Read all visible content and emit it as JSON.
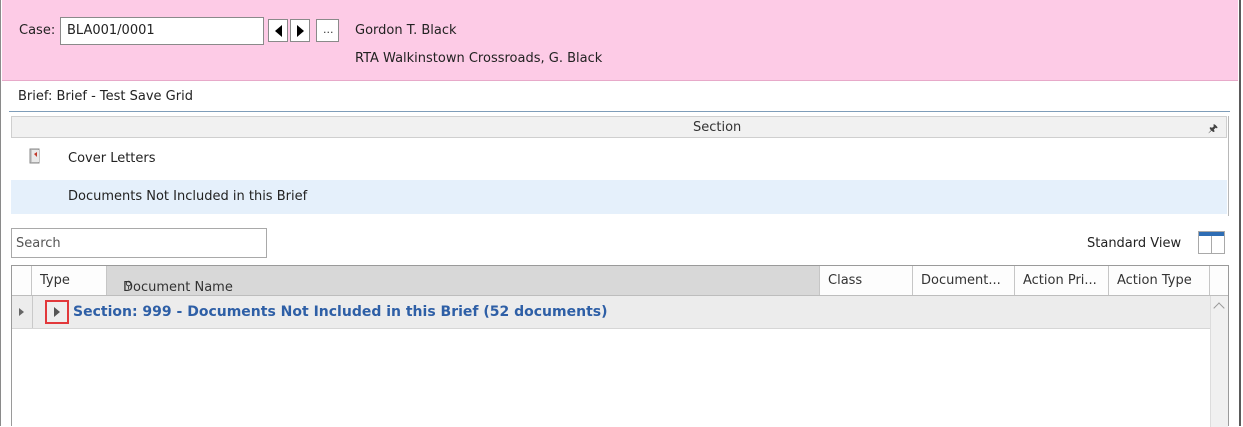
{
  "case": {
    "label": "Case:",
    "value": "BLA001/0001",
    "more_label": "...",
    "client_name": "Gordon T. Black",
    "description": "RTA Walkinstown Crossroads, G. Black",
    "background_color": "#fdcbe6"
  },
  "brief": {
    "title": "Brief: Brief - Test Save Grid"
  },
  "section_panel": {
    "header": "Section",
    "pin_icon": "pin-icon",
    "rows": [
      {
        "label": "Cover Letters",
        "icon": "book-icon"
      },
      {
        "label": "Documents Not Included in this Brief",
        "selected": true
      }
    ]
  },
  "search": {
    "placeholder": "Search",
    "value": ""
  },
  "view": {
    "label": "Standard View",
    "icon": "layout-icon"
  },
  "grid": {
    "columns": [
      "Type",
      "Document Name",
      "Class",
      "Document...",
      "Action Pri...",
      "Action Type"
    ],
    "group_row": {
      "section_label": "Section: 999",
      "separator": " - ",
      "description": "Documents Not Included in this Brief (52 documents)"
    },
    "accent_color": "#2e5fa6",
    "highlight_color": "#e2383b"
  }
}
